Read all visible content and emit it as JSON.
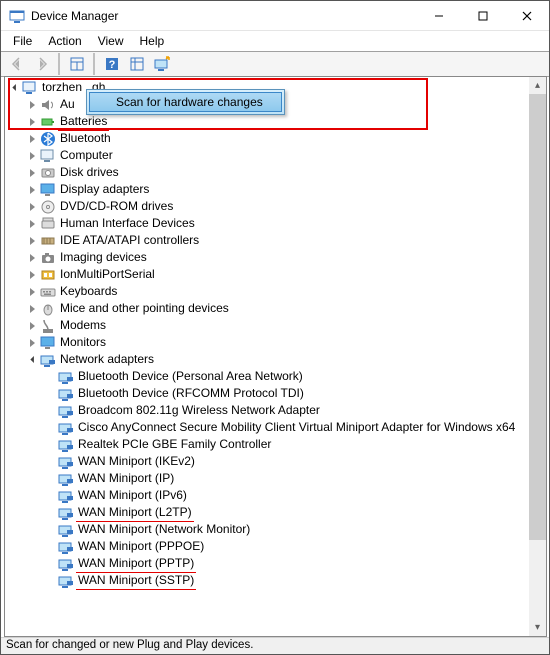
{
  "window": {
    "title": "Device Manager"
  },
  "menu": {
    "file": "File",
    "action": "Action",
    "view": "View",
    "help": "Help"
  },
  "ctx": {
    "scan": "Scan for hardware changes"
  },
  "root": {
    "name": "torzhen",
    "suffix": "gh"
  },
  "categories": {
    "audio": "Au",
    "batteries": "Batteries",
    "bluetooth": "Bluetooth",
    "computer": "Computer",
    "disk": "Disk drives",
    "display": "Display adapters",
    "dvd": "DVD/CD-ROM drives",
    "hid": "Human Interface Devices",
    "ide": "IDE ATA/ATAPI controllers",
    "imaging": "Imaging devices",
    "ionmulti": "IonMultiPortSerial",
    "keyboards": "Keyboards",
    "mice": "Mice and other pointing devices",
    "modems": "Modems",
    "monitors": "Monitors",
    "network": "Network adapters"
  },
  "network_items": {
    "bt_pan": "Bluetooth Device (Personal Area Network)",
    "bt_rfcomm": "Bluetooth Device (RFCOMM Protocol TDI)",
    "broadcom": "Broadcom 802.11g Wireless Network Adapter",
    "cisco": "Cisco AnyConnect Secure Mobility Client Virtual Miniport Adapter for Windows x64",
    "realtek": "Realtek PCIe GBE Family Controller",
    "wan_ikev2": "WAN Miniport (IKEv2)",
    "wan_ip": "WAN Miniport (IP)",
    "wan_ipv6": "WAN Miniport (IPv6)",
    "wan_l2tp": "WAN Miniport (L2TP)",
    "wan_netmon": "WAN Miniport (Network Monitor)",
    "wan_pppoe": "WAN Miniport (PPPOE)",
    "wan_pptp": "WAN Miniport (PPTP)",
    "wan_sstp": "WAN Miniport (SSTP)"
  },
  "status": "Scan for changed or new Plug and Play devices."
}
